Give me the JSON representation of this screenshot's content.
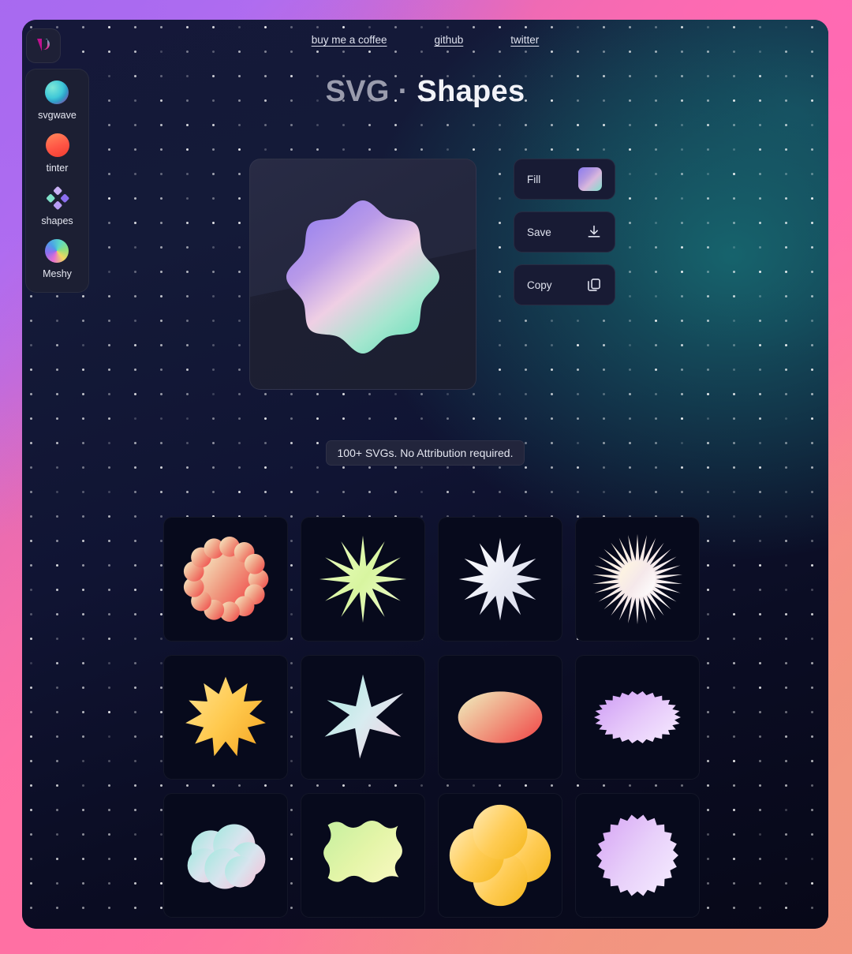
{
  "app": {
    "title_part1": "SVG",
    "title_sep": " · ",
    "title_part2": "Shapes",
    "logo_name": "svgwave-logo"
  },
  "nav": {
    "links": [
      {
        "label": "buy me a coffee",
        "name": "nav-link-buy-me-a-coffee"
      },
      {
        "label": "github",
        "name": "nav-link-github"
      },
      {
        "label": "twitter",
        "name": "nav-link-twitter"
      }
    ]
  },
  "sidebar": {
    "items": [
      {
        "label": "svgwave",
        "icon": "svgwave-sphere-icon",
        "colors": [
          "#44d6c8",
          "#7fd8e8",
          "#c0349a"
        ]
      },
      {
        "label": "tinter",
        "icon": "tinter-circle-icon",
        "colors": [
          "#ff7a4d",
          "#ff4a4a",
          "#ff3b30"
        ]
      },
      {
        "label": "shapes",
        "icon": "shapes-diamond-icon",
        "colors": [
          "#7ee0c8",
          "#b79cf5",
          "#8b6ef0"
        ]
      },
      {
        "label": "Meshy",
        "icon": "meshy-sphere-icon",
        "colors": [
          "#e86fd0",
          "#5aa9f0",
          "#6fd98f"
        ]
      }
    ]
  },
  "controls": {
    "fill": {
      "label": "Fill",
      "icon": "fill-swatch",
      "swatch_colors": [
        "#8b7cf0",
        "#d9a8dd",
        "#6fe0c0"
      ]
    },
    "save": {
      "label": "Save",
      "icon": "download-icon"
    },
    "copy": {
      "label": "Copy",
      "icon": "copy-icon"
    }
  },
  "badge": {
    "text": "100+ SVGs. No Attribution required."
  },
  "preview": {
    "shape": "rounded-8-point-star-blob",
    "gradient": [
      "#8f7cf2",
      "#c9a8e8",
      "#f0c8e0",
      "#9ae8d0",
      "#6fe0bc"
    ]
  },
  "gallery": {
    "shapes": [
      {
        "name": "wavy-blob",
        "colors": [
          "#f5e6c0",
          "#f09a80",
          "#f04a4a"
        ]
      },
      {
        "name": "spiky-star-12",
        "colors": [
          "#eaffc0",
          "#d8f5a0",
          "#f0ffd0"
        ]
      },
      {
        "name": "star-burst-12",
        "colors": [
          "#ffffff",
          "#e8eaf5",
          "#d8dbeb"
        ]
      },
      {
        "name": "sunburst-rays",
        "colors": [
          "#fff6e0",
          "#f5e8ea",
          "#ffffff"
        ]
      },
      {
        "name": "amber-burst",
        "colors": [
          "#ffe08a",
          "#ffc94d",
          "#f5a623"
        ]
      },
      {
        "name": "sparkle-8-point",
        "colors": [
          "#aee8e0",
          "#d8ecf0",
          "#f0cde0"
        ]
      },
      {
        "name": "ellipse",
        "colors": [
          "#efe6b8",
          "#f09a80",
          "#f04a4a"
        ]
      },
      {
        "name": "spiky-ellipse",
        "colors": [
          "#d0a0f5",
          "#e6c8fa",
          "#f5eaff"
        ]
      },
      {
        "name": "cloud",
        "colors": [
          "#a8e8e0",
          "#d8e4ee",
          "#f0c8dc"
        ]
      },
      {
        "name": "wavy-square",
        "colors": [
          "#c8f0a0",
          "#e4f5a8",
          "#f8f8c0"
        ]
      },
      {
        "name": "clover-4-lobe",
        "colors": [
          "#ffe6a8",
          "#ffcc55",
          "#f5b820"
        ]
      },
      {
        "name": "scalloped-circle",
        "colors": [
          "#d8a8f5",
          "#e8d0fa",
          "#f5ecff"
        ]
      }
    ]
  }
}
